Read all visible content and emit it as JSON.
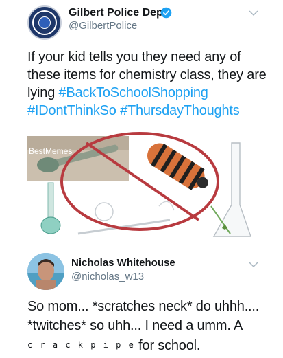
{
  "tweet": {
    "display_name": "Gilbert Police Dept.",
    "handle": "@GilbertPolice",
    "text_lines": [
      "If your kid tells you they need any of",
      "these items for chemistry class, they are",
      "lying "
    ],
    "hashtags": [
      "#BackToSchoolShopping",
      "#IDontThinkSo",
      "#ThursdayThoughts"
    ],
    "media_watermark": "BestMemes"
  },
  "reply": {
    "display_name": "Nicholas Whitehouse",
    "handle": "@nicholas_w13",
    "text_line_1": "So mom... *scratches neck* do uhhh....",
    "text_line_2": "*twitches* so uhh... I need a umm. A",
    "spaced_word": "c r a c k p i p e",
    "text_end": " for school."
  },
  "colors": {
    "hashtag": "#1da1f2",
    "handle": "#657786",
    "verified": "#1da1f2",
    "prohibition": "#b83a3f"
  },
  "icons": [
    "verified-badge-icon",
    "chevron-down-icon"
  ]
}
